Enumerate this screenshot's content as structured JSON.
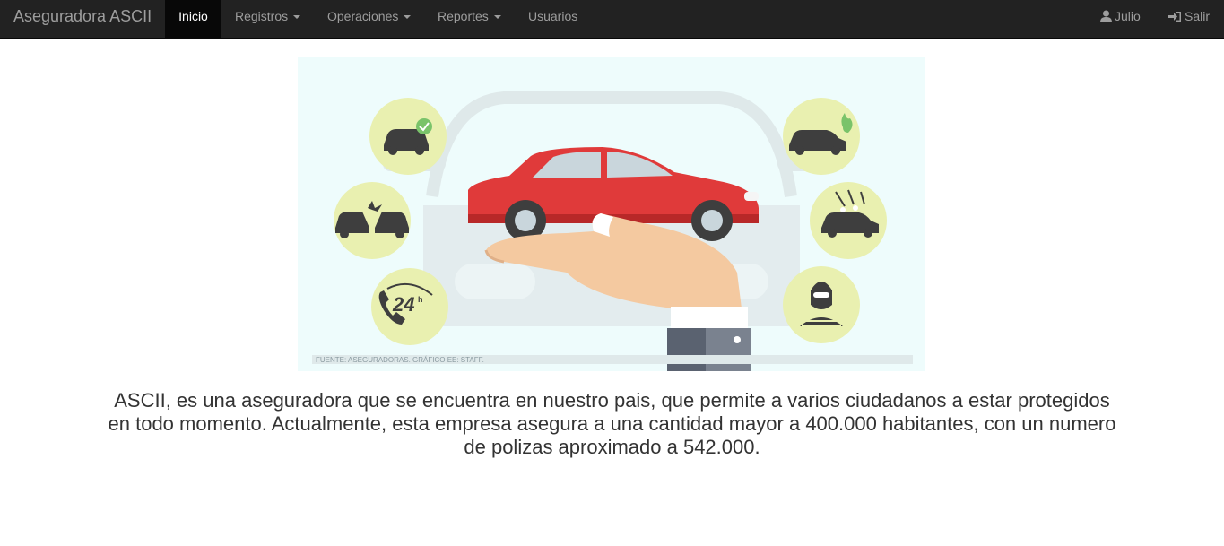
{
  "navbar": {
    "brand": "Aseguradora ASCII",
    "items": [
      {
        "label": "Inicio",
        "active": true,
        "dropdown": false
      },
      {
        "label": "Registros",
        "active": false,
        "dropdown": true
      },
      {
        "label": "Operaciones",
        "active": false,
        "dropdown": true
      },
      {
        "label": "Reportes",
        "active": false,
        "dropdown": true
      },
      {
        "label": "Usuarios",
        "active": false,
        "dropdown": false
      }
    ],
    "user_label": "Julio",
    "logout_label": "Salir",
    "icons": {
      "user": "user-icon",
      "logout": "logout-icon"
    }
  },
  "hero": {
    "caption": "FUENTE: ASEGURADORAS. GRÁFICO EE: STAFF.",
    "badge_24h": "24",
    "badge_24h_suffix": "h",
    "icons": [
      "car-check-icon",
      "car-crash-icon",
      "phone-24h-icon",
      "car-fire-icon",
      "car-hail-icon",
      "thief-icon",
      "red-car-icon",
      "hand-icon"
    ]
  },
  "main": {
    "description": "ASCII, es una aseguradora que se encuentra en nuestro pais, que permite a varios ciudadanos a estar protegidos en todo momento. Actualmente, esta empresa asegura a una cantidad mayor a 400.000 habitantes, con un numero de polizas aproximado a 542.000."
  },
  "colors": {
    "navbar_bg": "#222222",
    "nav_text": "#9d9d9d",
    "active_bg": "#080808",
    "hero_bg": "#eefcfc",
    "badge": "#e9f0b0",
    "car_red": "#e03a3a"
  }
}
